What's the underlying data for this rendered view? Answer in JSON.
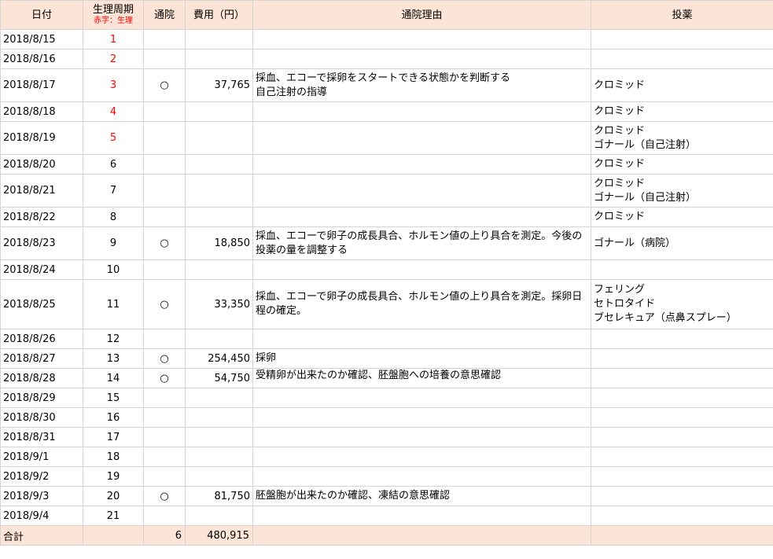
{
  "header": {
    "date": "日付",
    "cycle": "生理周期",
    "cycle_note": "赤字：生理",
    "visit": "通院",
    "cost": "費用（円）",
    "reason": "通院理由",
    "medication": "投薬"
  },
  "colors": {
    "header_bg": "#fce4d6",
    "period_red": "#ff0000",
    "grid": "#d4d4d4"
  },
  "rows": [
    {
      "date": "2018/8/15",
      "cycle": "1",
      "period": true,
      "visit": "",
      "cost": "",
      "reason": [],
      "medication": []
    },
    {
      "date": "2018/8/16",
      "cycle": "2",
      "period": true,
      "visit": "",
      "cost": "",
      "reason": [],
      "medication": []
    },
    {
      "date": "2018/8/17",
      "cycle": "3",
      "period": true,
      "visit": "○",
      "cost": "37,765",
      "reason": [
        "採血、エコーで採卵をスタートできる状態かを判断する",
        "自己注射の指導"
      ],
      "medication": [
        "クロミッド"
      ]
    },
    {
      "date": "2018/8/18",
      "cycle": "4",
      "period": true,
      "visit": "",
      "cost": "",
      "reason": [],
      "medication": [
        "クロミッド"
      ]
    },
    {
      "date": "2018/8/19",
      "cycle": "5",
      "period": true,
      "visit": "",
      "cost": "",
      "reason": [],
      "medication": [
        "クロミッド",
        "ゴナール（自己注射）"
      ]
    },
    {
      "date": "2018/8/20",
      "cycle": "6",
      "period": false,
      "visit": "",
      "cost": "",
      "reason": [],
      "medication": [
        "クロミッド"
      ]
    },
    {
      "date": "2018/8/21",
      "cycle": "7",
      "period": false,
      "visit": "",
      "cost": "",
      "reason": [],
      "medication": [
        "クロミッド",
        "ゴナール（自己注射）"
      ]
    },
    {
      "date": "2018/8/22",
      "cycle": "8",
      "period": false,
      "visit": "",
      "cost": "",
      "reason": [],
      "medication": [
        "クロミッド"
      ]
    },
    {
      "date": "2018/8/23",
      "cycle": "9",
      "period": false,
      "visit": "○",
      "cost": "18,850",
      "reason": [
        "採血、エコーで卵子の成長具合、ホルモン値の上り具合を測定。今後の",
        "投薬の量を調整する"
      ],
      "medication": [
        "ゴナール（病院）"
      ]
    },
    {
      "date": "2018/8/24",
      "cycle": "10",
      "period": false,
      "visit": "",
      "cost": "",
      "reason": [],
      "medication": []
    },
    {
      "date": "2018/8/25",
      "cycle": "11",
      "period": false,
      "visit": "○",
      "cost": "33,350",
      "reason": [
        "採血、エコーで卵子の成長具合、ホルモン値の上り具合を測定。採卵日",
        "程の確定。"
      ],
      "medication": [
        "フェリング",
        "セトロタイド",
        "ブセレキュア（点鼻スプレー）"
      ]
    },
    {
      "date": "2018/8/26",
      "cycle": "12",
      "period": false,
      "visit": "",
      "cost": "",
      "reason": [],
      "medication": []
    },
    {
      "date": "2018/8/27",
      "cycle": "13",
      "period": false,
      "visit": "○",
      "cost": "254,450",
      "reason": [
        "採卵"
      ],
      "medication": []
    },
    {
      "date": "2018/8/28",
      "cycle": "14",
      "period": false,
      "visit": "○",
      "cost": "54,750",
      "reason": [
        "受精卵が出来たのか確認、胚盤胞への培養の意思確認"
      ],
      "medication": []
    },
    {
      "date": "2018/8/29",
      "cycle": "15",
      "period": false,
      "visit": "",
      "cost": "",
      "reason": [],
      "medication": []
    },
    {
      "date": "2018/8/30",
      "cycle": "16",
      "period": false,
      "visit": "",
      "cost": "",
      "reason": [],
      "medication": []
    },
    {
      "date": "2018/8/31",
      "cycle": "17",
      "period": false,
      "visit": "",
      "cost": "",
      "reason": [],
      "medication": []
    },
    {
      "date": "2018/9/1",
      "cycle": "18",
      "period": false,
      "visit": "",
      "cost": "",
      "reason": [],
      "medication": []
    },
    {
      "date": "2018/9/2",
      "cycle": "19",
      "period": false,
      "visit": "",
      "cost": "",
      "reason": [],
      "medication": []
    },
    {
      "date": "2018/9/3",
      "cycle": "20",
      "period": false,
      "visit": "○",
      "cost": "81,750",
      "reason": [
        "胚盤胞が出来たのか確認、凍結の意思確認"
      ],
      "medication": []
    },
    {
      "date": "2018/9/4",
      "cycle": "21",
      "period": false,
      "visit": "",
      "cost": "",
      "reason": [],
      "medication": []
    }
  ],
  "total": {
    "label": "合計",
    "visits": "6",
    "cost": "480,915"
  }
}
